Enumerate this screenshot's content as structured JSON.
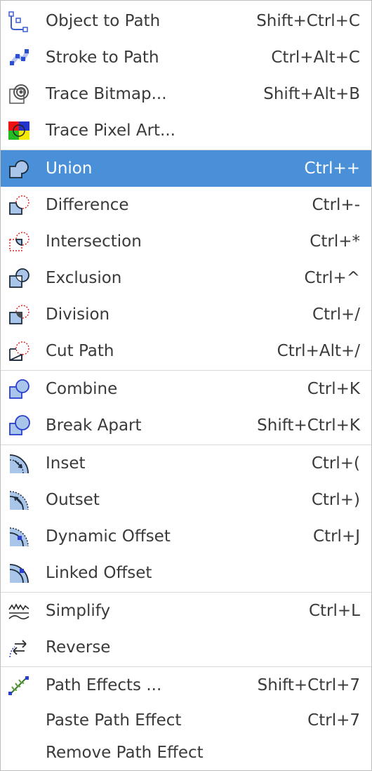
{
  "colors": {
    "highlight": "#4a90d9",
    "separator": "#d9d9d9",
    "text": "#3a3a3a"
  },
  "menu": {
    "items": [
      {
        "label": "Object to Path",
        "accel": "Shift+Ctrl+C",
        "icon": "object-to-path-icon"
      },
      {
        "label": "Stroke to Path",
        "accel": "Ctrl+Alt+C",
        "icon": "stroke-to-path-icon"
      },
      {
        "label": "Trace Bitmap...",
        "accel": "Shift+Alt+B",
        "icon": "trace-bitmap-icon"
      },
      {
        "label": "Trace Pixel Art...",
        "accel": "",
        "icon": "trace-pixel-art-icon"
      },
      {
        "label": "Union",
        "accel": "Ctrl++",
        "icon": "union-icon",
        "highlighted": true
      },
      {
        "label": "Difference",
        "accel": "Ctrl+-",
        "icon": "difference-icon"
      },
      {
        "label": "Intersection",
        "accel": "Ctrl+*",
        "icon": "intersection-icon"
      },
      {
        "label": "Exclusion",
        "accel": "Ctrl+^",
        "icon": "exclusion-icon"
      },
      {
        "label": "Division",
        "accel": "Ctrl+/",
        "icon": "division-icon"
      },
      {
        "label": "Cut Path",
        "accel": "Ctrl+Alt+/",
        "icon": "cut-path-icon"
      },
      {
        "label": "Combine",
        "accel": "Ctrl+K",
        "icon": "combine-icon"
      },
      {
        "label": "Break Apart",
        "accel": "Shift+Ctrl+K",
        "icon": "break-apart-icon"
      },
      {
        "label": "Inset",
        "accel": "Ctrl+(",
        "icon": "inset-icon"
      },
      {
        "label": "Outset",
        "accel": "Ctrl+)",
        "icon": "outset-icon"
      },
      {
        "label": "Dynamic Offset",
        "accel": "Ctrl+J",
        "icon": "dynamic-offset-icon"
      },
      {
        "label": "Linked Offset",
        "accel": "",
        "icon": "linked-offset-icon"
      },
      {
        "label": "Simplify",
        "accel": "Ctrl+L",
        "icon": "simplify-icon"
      },
      {
        "label": "Reverse",
        "accel": "",
        "icon": "reverse-icon"
      },
      {
        "label": "Path Effects ...",
        "accel": "Shift+Ctrl+7",
        "icon": "path-effects-icon"
      },
      {
        "label": "Paste Path Effect",
        "accel": "Ctrl+7",
        "icon": ""
      },
      {
        "label": "Remove Path Effect",
        "accel": "",
        "icon": ""
      }
    ]
  }
}
